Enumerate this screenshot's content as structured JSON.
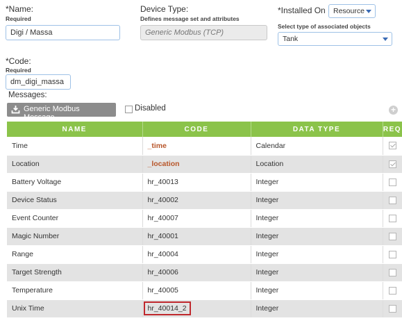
{
  "form": {
    "name_label": "*Name:",
    "name_required": "Required",
    "name_value": "Digi / Massa",
    "device_type_label": "Device Type:",
    "device_type_hint": "Defines message set and attributes",
    "device_type_value": "Generic Modbus (TCP)",
    "installed_on_label": "*Installed On",
    "installed_on_value": "Resource",
    "associated_label": "Select type of associated objects",
    "associated_value": "Tank",
    "code_label": "*Code:",
    "code_required": "Required",
    "code_value": "dm_digi_massa",
    "messages_label": "Messages:",
    "message_button": "Generic Modbus Message",
    "disabled_label": "Disabled"
  },
  "table": {
    "headers": [
      "NAME",
      "CODE",
      "DATA TYPE",
      "REQ"
    ],
    "rows": [
      {
        "name": "Time",
        "code": "_time",
        "type": "Calendar",
        "req": true,
        "system": true
      },
      {
        "name": "Location",
        "code": "_location",
        "type": "Location",
        "req": true,
        "system": true
      },
      {
        "name": "Battery Voltage",
        "code": "hr_40013",
        "type": "Integer",
        "req": false
      },
      {
        "name": "Device Status",
        "code": "hr_40002",
        "type": "Integer",
        "req": false
      },
      {
        "name": "Event Counter",
        "code": "hr_40007",
        "type": "Integer",
        "req": false
      },
      {
        "name": "Magic Number",
        "code": "hr_40001",
        "type": "Integer",
        "req": false
      },
      {
        "name": "Range",
        "code": "hr_40004",
        "type": "Integer",
        "req": false
      },
      {
        "name": "Target Strength",
        "code": "hr_40006",
        "type": "Integer",
        "req": false
      },
      {
        "name": "Temperature",
        "code": "hr_40005",
        "type": "Integer",
        "req": false
      },
      {
        "name": "Unix Time",
        "code": "hr_40014_2",
        "type": "Integer",
        "req": false,
        "highlight": true
      }
    ]
  },
  "colors": {
    "header_green": "#8bc34a",
    "system_code": "#b8562a",
    "highlight_border": "#c0282d"
  }
}
